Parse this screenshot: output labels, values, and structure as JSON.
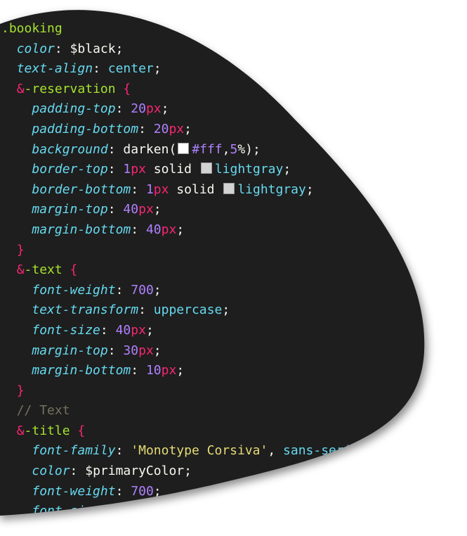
{
  "code_lines": [
    {
      "tokens": [
        {
          "text": ".booking",
          "cls": "sel"
        }
      ]
    },
    {
      "tokens": [
        {
          "text": "  "
        },
        {
          "text": "color",
          "cls": "prop"
        },
        {
          "text": ": ",
          "cls": "punc"
        },
        {
          "text": "$black",
          "cls": "var"
        },
        {
          "text": ";",
          "cls": "punc"
        }
      ]
    },
    {
      "tokens": [
        {
          "text": "  "
        },
        {
          "text": "text-align",
          "cls": "prop"
        },
        {
          "text": ": ",
          "cls": "punc"
        },
        {
          "text": "center",
          "cls": "kw"
        },
        {
          "text": ";",
          "cls": "punc"
        }
      ]
    },
    {
      "tokens": [
        {
          "text": "  "
        },
        {
          "text": "&",
          "cls": "amp"
        },
        {
          "text": "-reservation",
          "cls": "sel"
        },
        {
          "text": " {",
          "cls": "brace"
        }
      ]
    },
    {
      "tokens": [
        {
          "text": "    "
        },
        {
          "text": "padding-top",
          "cls": "prop"
        },
        {
          "text": ": ",
          "cls": "punc"
        },
        {
          "text": "20",
          "cls": "num"
        },
        {
          "text": "px",
          "cls": "unit"
        },
        {
          "text": ";",
          "cls": "punc"
        }
      ]
    },
    {
      "tokens": [
        {
          "text": "    "
        },
        {
          "text": "padding-bottom",
          "cls": "prop"
        },
        {
          "text": ": ",
          "cls": "punc"
        },
        {
          "text": "20",
          "cls": "num"
        },
        {
          "text": "px",
          "cls": "unit"
        },
        {
          "text": ";",
          "cls": "punc"
        }
      ]
    },
    {
      "tokens": [
        {
          "text": "    "
        },
        {
          "text": "background",
          "cls": "prop"
        },
        {
          "text": ": ",
          "cls": "punc"
        },
        {
          "text": "darken(",
          "cls": "txt"
        },
        {
          "swatch": "#ffffff"
        },
        {
          "text": "#fff",
          "cls": "hex"
        },
        {
          "text": ",",
          "cls": "punc"
        },
        {
          "text": "5",
          "cls": "num"
        },
        {
          "text": "%);",
          "cls": "punc"
        }
      ]
    },
    {
      "tokens": [
        {
          "text": "    "
        },
        {
          "text": "border-top",
          "cls": "prop"
        },
        {
          "text": ": ",
          "cls": "punc"
        },
        {
          "text": "1",
          "cls": "num"
        },
        {
          "text": "px",
          "cls": "unit"
        },
        {
          "text": " solid ",
          "cls": "txt"
        },
        {
          "swatch": "#d3d3d3"
        },
        {
          "text": "lightgray",
          "cls": "kw"
        },
        {
          "text": ";",
          "cls": "punc"
        }
      ]
    },
    {
      "tokens": [
        {
          "text": "    "
        },
        {
          "text": "border-bottom",
          "cls": "prop"
        },
        {
          "text": ": ",
          "cls": "punc"
        },
        {
          "text": "1",
          "cls": "num"
        },
        {
          "text": "px",
          "cls": "unit"
        },
        {
          "text": " solid ",
          "cls": "txt"
        },
        {
          "swatch": "#d3d3d3"
        },
        {
          "text": "lightgray",
          "cls": "kw"
        },
        {
          "text": ";",
          "cls": "punc"
        }
      ]
    },
    {
      "tokens": [
        {
          "text": "    "
        },
        {
          "text": "margin-top",
          "cls": "prop"
        },
        {
          "text": ": ",
          "cls": "punc"
        },
        {
          "text": "40",
          "cls": "num"
        },
        {
          "text": "px",
          "cls": "unit"
        },
        {
          "text": ";",
          "cls": "punc"
        }
      ]
    },
    {
      "tokens": [
        {
          "text": "    "
        },
        {
          "text": "margin-bottom",
          "cls": "prop"
        },
        {
          "text": ": ",
          "cls": "punc"
        },
        {
          "text": "40",
          "cls": "num"
        },
        {
          "text": "px",
          "cls": "unit"
        },
        {
          "text": ";",
          "cls": "punc"
        }
      ]
    },
    {
      "tokens": [
        {
          "text": "  "
        },
        {
          "text": "}",
          "cls": "brace"
        }
      ]
    },
    {
      "tokens": [
        {
          "text": "  "
        },
        {
          "text": "&",
          "cls": "amp"
        },
        {
          "text": "-text",
          "cls": "sel"
        },
        {
          "text": " {",
          "cls": "brace"
        }
      ]
    },
    {
      "tokens": [
        {
          "text": "    "
        },
        {
          "text": "font-weight",
          "cls": "prop"
        },
        {
          "text": ": ",
          "cls": "punc"
        },
        {
          "text": "700",
          "cls": "num"
        },
        {
          "text": ";",
          "cls": "punc"
        }
      ]
    },
    {
      "tokens": [
        {
          "text": "    "
        },
        {
          "text": "text-transform",
          "cls": "prop"
        },
        {
          "text": ": ",
          "cls": "punc"
        },
        {
          "text": "uppercase",
          "cls": "kw"
        },
        {
          "text": ";",
          "cls": "punc"
        }
      ]
    },
    {
      "tokens": [
        {
          "text": "    "
        },
        {
          "text": "font-size",
          "cls": "prop"
        },
        {
          "text": ": ",
          "cls": "punc"
        },
        {
          "text": "40",
          "cls": "num"
        },
        {
          "text": "px",
          "cls": "unit"
        },
        {
          "text": ";",
          "cls": "punc"
        }
      ]
    },
    {
      "tokens": [
        {
          "text": "    "
        },
        {
          "text": "margin-top",
          "cls": "prop"
        },
        {
          "text": ": ",
          "cls": "punc"
        },
        {
          "text": "30",
          "cls": "num"
        },
        {
          "text": "px",
          "cls": "unit"
        },
        {
          "text": ";",
          "cls": "punc"
        }
      ]
    },
    {
      "tokens": [
        {
          "text": "    "
        },
        {
          "text": "margin-bottom",
          "cls": "prop"
        },
        {
          "text": ": ",
          "cls": "punc"
        },
        {
          "text": "10",
          "cls": "num"
        },
        {
          "text": "px",
          "cls": "unit"
        },
        {
          "text": ";",
          "cls": "punc"
        }
      ]
    },
    {
      "tokens": [
        {
          "text": "  "
        },
        {
          "text": "}",
          "cls": "brace"
        }
      ]
    },
    {
      "tokens": [
        {
          "text": "  "
        },
        {
          "text": "// Text",
          "cls": "cmt"
        }
      ]
    },
    {
      "tokens": [
        {
          "text": "  "
        },
        {
          "text": "&",
          "cls": "amp"
        },
        {
          "text": "-title",
          "cls": "sel"
        },
        {
          "text": " {",
          "cls": "brace"
        }
      ]
    },
    {
      "tokens": [
        {
          "text": "    "
        },
        {
          "text": "font-family",
          "cls": "prop"
        },
        {
          "text": ": ",
          "cls": "punc"
        },
        {
          "text": "'Monotype Corsiva'",
          "cls": "str"
        },
        {
          "text": ", ",
          "cls": "punc"
        },
        {
          "text": "sans-serif",
          "cls": "kw"
        },
        {
          "text": ";",
          "cls": "punc"
        }
      ]
    },
    {
      "tokens": [
        {
          "text": "    "
        },
        {
          "text": "color",
          "cls": "prop"
        },
        {
          "text": ": ",
          "cls": "punc"
        },
        {
          "text": "$primaryColor",
          "cls": "var"
        },
        {
          "text": ";",
          "cls": "punc"
        }
      ]
    },
    {
      "tokens": [
        {
          "text": "    "
        },
        {
          "text": "font-weight",
          "cls": "prop"
        },
        {
          "text": ": ",
          "cls": "punc"
        },
        {
          "text": "700",
          "cls": "num"
        },
        {
          "text": ";",
          "cls": "punc"
        }
      ]
    },
    {
      "tokens": [
        {
          "text": "    "
        },
        {
          "text": "font-size",
          "cls": "prop"
        },
        {
          "text": ": ",
          "cls": "punc"
        }
      ]
    }
  ],
  "colors": {
    "editor_background": "#1e1e1e",
    "selector": "#a6e22e",
    "property": "#66d9ef",
    "number": "#ae81ff",
    "unit": "#f92672",
    "string": "#e6db74",
    "comment": "#75715e"
  }
}
